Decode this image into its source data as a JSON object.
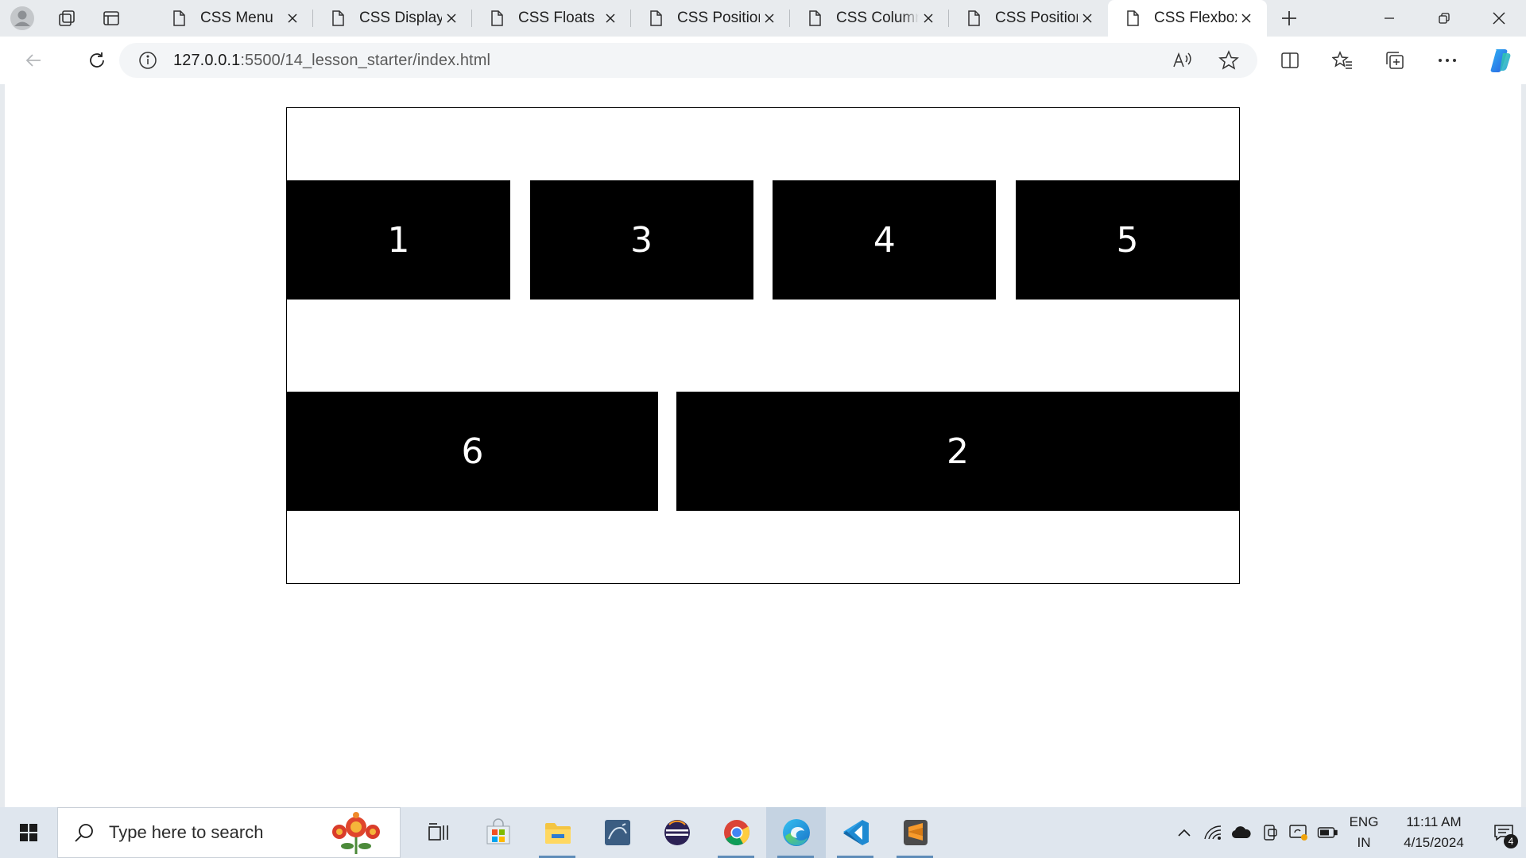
{
  "browser": {
    "tabs": [
      {
        "label": "CSS Menu",
        "active": false
      },
      {
        "label": "CSS Display",
        "active": false
      },
      {
        "label": "CSS Floats",
        "active": false
      },
      {
        "label": "CSS Position",
        "active": false
      },
      {
        "label": "CSS Columns",
        "active": false
      },
      {
        "label": "CSS Position",
        "active": false
      },
      {
        "label": "CSS Flexbox",
        "active": true
      }
    ],
    "address": {
      "host": "127.0.0.1",
      "path": ":5500/14_lesson_starter/index.html"
    }
  },
  "page": {
    "row1": [
      "1",
      "3",
      "4",
      "5"
    ],
    "row2": [
      "6",
      "2"
    ]
  },
  "taskbar": {
    "search_placeholder": "Type here to search",
    "apps": [
      "task-view",
      "microsoft-store",
      "file-explorer",
      "mysql-workbench",
      "eclipse",
      "chrome",
      "edge",
      "vscode",
      "sublime-text"
    ],
    "language": {
      "line1": "ENG",
      "line2": "IN"
    },
    "clock": {
      "time": "11:11 AM",
      "date": "4/15/2024"
    },
    "notification_count": "4"
  },
  "colors": {
    "accent": "#0067c0",
    "flex_item_bg": "#000000",
    "flex_item_text": "#ffffff"
  }
}
